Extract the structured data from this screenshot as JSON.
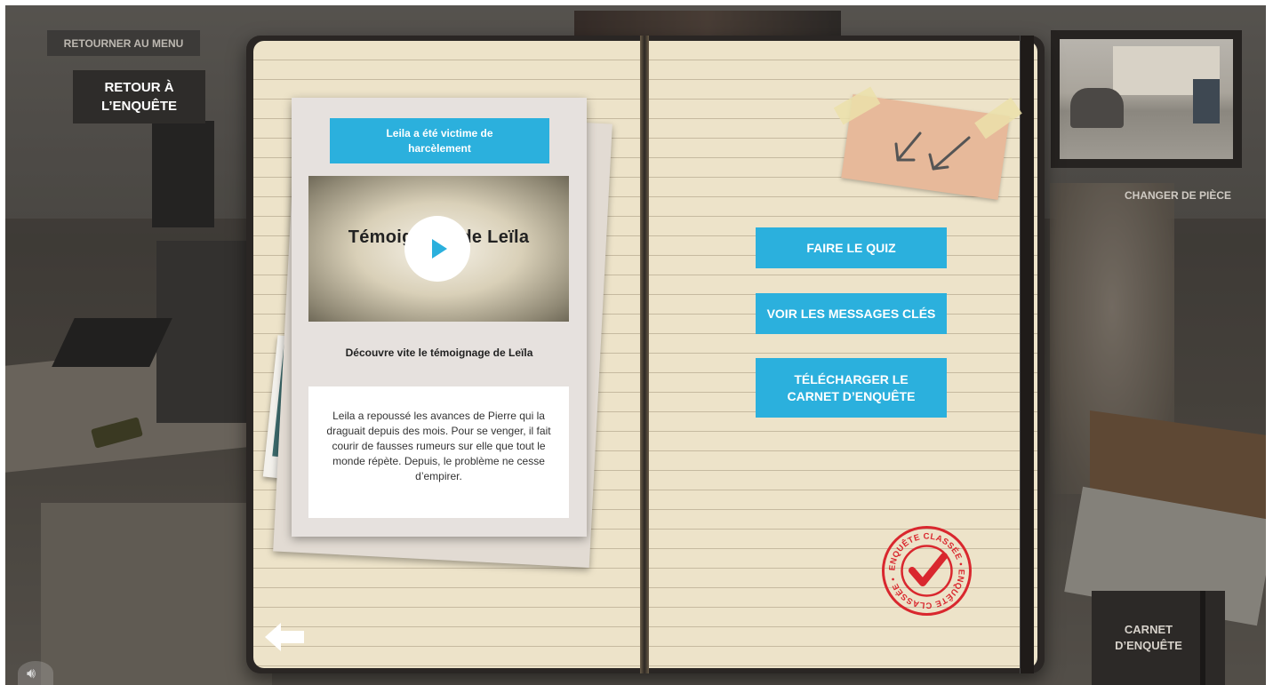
{
  "nav": {
    "menu_label": "RETOURNER AU MENU",
    "retour_label": "RETOUR À L’ENQUÊTE",
    "change_room_label": "CHANGER DE PIÈCE",
    "carnet_label": "CARNET D’ENQUÊTE"
  },
  "card": {
    "title": "Leila a été victime de harcèlement",
    "video_title": "Témoignage de Leïla",
    "subtitle": "Découvre vite le témoignage de Leïla",
    "description": "Leila a repoussé les avances de Pierre qui la draguait depuis des mois. Pour se venger, il fait courir de fausses rumeurs sur elle que tout le monde répète. Depuis, le problème ne cesse d’empirer."
  },
  "actions": {
    "quiz_label": "FAIRE LE QUIZ",
    "messages_label": "VOIR LES MESSAGES CLÉS",
    "download_label": "TÉLÉCHARGER LE CARNET D’ENQUÊTE"
  },
  "stamp": {
    "text": "ENQUÊTE CLASSÉE • ENQUÊTE CLASSÉE •"
  },
  "icons": {
    "play": "play-icon",
    "back_arrow": "arrow-left-icon",
    "sound": "sound-icon",
    "stamp_check": "checkmark-icon"
  },
  "colors": {
    "accent": "#2bb0dd",
    "stamp_red": "#d9272e",
    "page": "#ede3c9"
  }
}
